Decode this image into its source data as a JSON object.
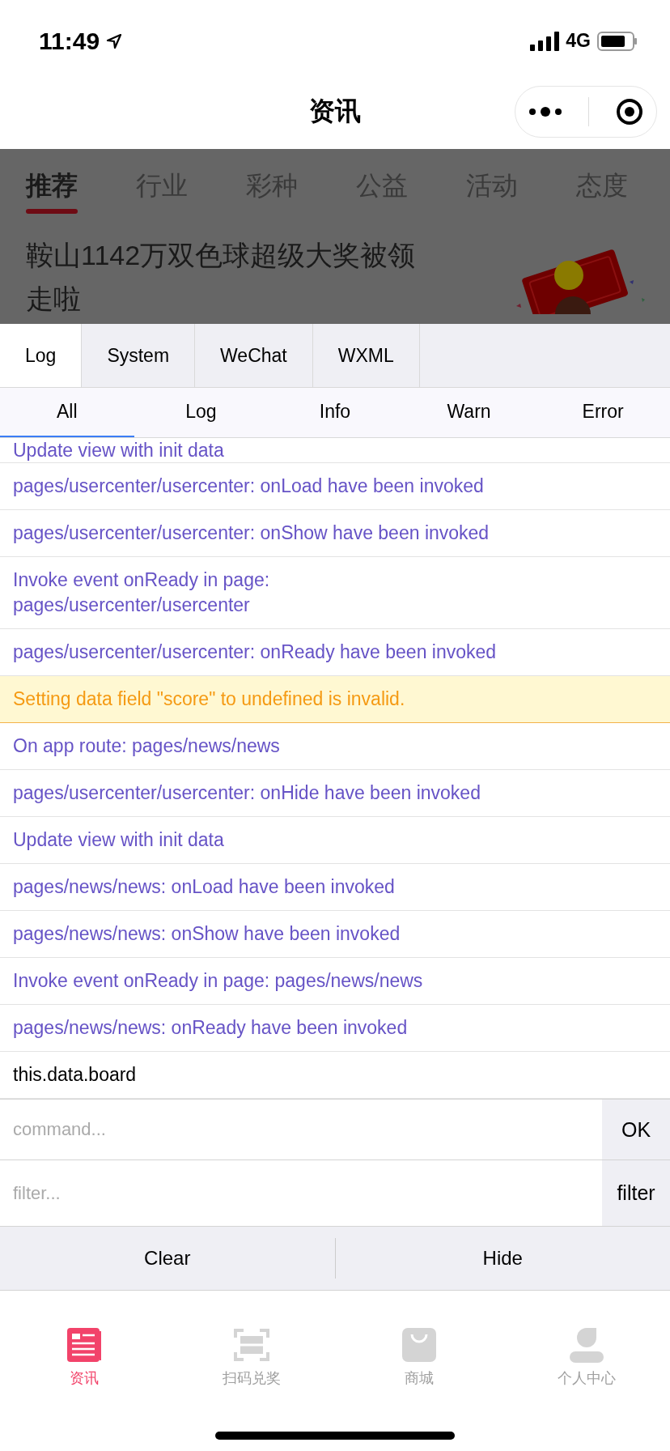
{
  "status_bar": {
    "time": "11:49",
    "network": "4G"
  },
  "nav": {
    "title": "资讯"
  },
  "categories": [
    {
      "label": "推荐",
      "selected": true
    },
    {
      "label": "行业",
      "selected": false
    },
    {
      "label": "彩种",
      "selected": false
    },
    {
      "label": "公益",
      "selected": false
    },
    {
      "label": "活动",
      "selected": false
    },
    {
      "label": "态度",
      "selected": false
    }
  ],
  "article": {
    "title": "鞍山1142万双色球超级大奖被领走啦"
  },
  "console": {
    "tabs": [
      {
        "label": "Log",
        "selected": true
      },
      {
        "label": "System",
        "selected": false
      },
      {
        "label": "WeChat",
        "selected": false
      },
      {
        "label": "WXML",
        "selected": false
      }
    ],
    "filters": [
      {
        "label": "All",
        "selected": true
      },
      {
        "label": "Log",
        "selected": false
      },
      {
        "label": "Info",
        "selected": false
      },
      {
        "label": "Warn",
        "selected": false
      },
      {
        "label": "Error",
        "selected": false
      }
    ],
    "logs": [
      {
        "text": "Update view with init data",
        "kind": "log"
      },
      {
        "text": "pages/usercenter/usercenter: onLoad have been invoked",
        "kind": "log"
      },
      {
        "text": "pages/usercenter/usercenter: onShow have been invoked",
        "kind": "log"
      },
      {
        "text": "Invoke event onReady in page: pages/usercenter/usercenter",
        "kind": "log"
      },
      {
        "text": "pages/usercenter/usercenter: onReady have been invoked",
        "kind": "log"
      },
      {
        "text": "Setting data field \"score\" to undefined is invalid.",
        "kind": "warn"
      },
      {
        "text": "On app route: pages/news/news",
        "kind": "log"
      },
      {
        "text": "pages/usercenter/usercenter: onHide have been invoked",
        "kind": "log"
      },
      {
        "text": "Update view with init data",
        "kind": "log"
      },
      {
        "text": "pages/news/news: onLoad have been invoked",
        "kind": "log"
      },
      {
        "text": "pages/news/news: onShow have been invoked",
        "kind": "log"
      },
      {
        "text": "Invoke event onReady in page: pages/news/news",
        "kind": "log"
      },
      {
        "text": "pages/news/news: onReady have been invoked",
        "kind": "log"
      },
      {
        "text": "this.data.board",
        "kind": "command"
      }
    ],
    "command": {
      "placeholder": "command...",
      "button": "OK"
    },
    "filter": {
      "placeholder": "filter...",
      "button": "filter"
    },
    "actions": [
      "Clear",
      "Hide"
    ]
  },
  "tabbar": [
    {
      "label": "资讯",
      "kind": "news",
      "selected": true
    },
    {
      "label": "扫码兑奖",
      "kind": "scan",
      "selected": false
    },
    {
      "label": "商城",
      "kind": "shop",
      "selected": false
    },
    {
      "label": "个人中心",
      "kind": "profile",
      "selected": false
    }
  ]
}
